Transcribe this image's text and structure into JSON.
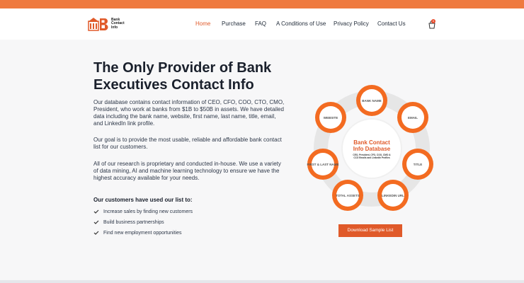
{
  "header": {
    "logo_text_lines": [
      "Bank",
      "Contact",
      "Info"
    ],
    "nav": [
      "Home",
      "Purchase",
      "FAQ",
      "A Conditions of Use",
      "Privacy Policy",
      "Contact Us"
    ],
    "cart_count": "0"
  },
  "hero": {
    "title_line1": "The Only Provider of Bank",
    "title_line2": "Executives Contact Info",
    "p1": "Our database contains contact information of CEO, CFO, COO, CTO, CMO, President, who work at banks from $1B to $50B in assets. We have detailed data including the bank name, website, first name, last name, title, email, and LinkedIn link profile.",
    "p2": "Our goal is to provide the most usable, reliable and affordable bank contact list for our customers.",
    "p3": "All of our research is proprietary and conducted in-house. We use a variety of data mining, AI and machine learning technology to ensure we have the highest accuracy available for your needs.",
    "list_heading": "Our customers have used our list to:",
    "list_items": [
      "Increase sales by finding new customers",
      "Build business partnerships",
      "Find new employment opportunities"
    ]
  },
  "diagram": {
    "center_title_1": "Bank Contact",
    "center_title_2": "Info Database",
    "center_sub_1": "CEO, President, CFO, COO, CMO &",
    "center_sub_2": "CCO Emails and LinkedIn Profiles",
    "nodes": [
      "BANK NAME",
      "EMAIL",
      "TITLE",
      "LINKEDIN URL",
      "TOTAL ASSETS",
      "FIRST & LAST NAME",
      "WEBSITE"
    ]
  },
  "cta_label": "Download Sample List",
  "colors": {
    "accent": "#e05a2a",
    "top_bar": "#ef7a3f"
  }
}
